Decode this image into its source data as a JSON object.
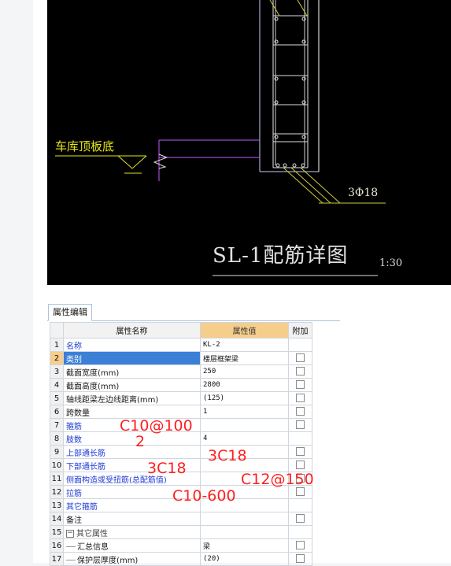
{
  "drawing": {
    "label_slab": "车库顶板底",
    "label_rebar": "3Φ18",
    "title": "SL-1配筋详图",
    "scale": "1:30"
  },
  "panel": {
    "tab_label": "属性编辑",
    "columns": {
      "name": "属性名称",
      "value": "属性值",
      "extra": "附加"
    },
    "rows": [
      {
        "num": "1",
        "name": "名称",
        "value": "KL-2",
        "color": "blue",
        "check": false
      },
      {
        "num": "2",
        "name": "类别",
        "value": "楼层框架梁",
        "color": "blue",
        "check": true
      },
      {
        "num": "3",
        "name": "截面宽度(mm)",
        "value": "250",
        "color": "black",
        "check": true
      },
      {
        "num": "4",
        "name": "截面高度(mm)",
        "value": "2800",
        "color": "black",
        "check": true
      },
      {
        "num": "5",
        "name": "轴线距梁左边线距离(mm)",
        "value": "(125)",
        "color": "black",
        "check": true
      },
      {
        "num": "6",
        "name": "跨数量",
        "value": "1",
        "color": "black",
        "check": true
      },
      {
        "num": "7",
        "name": "箍筋",
        "value": "",
        "color": "blue",
        "check": true
      },
      {
        "num": "8",
        "name": "肢数",
        "value": "4",
        "color": "blue",
        "check": false
      },
      {
        "num": "9",
        "name": "上部通长筋",
        "value": "",
        "color": "blue",
        "check": true
      },
      {
        "num": "10",
        "name": "下部通长筋",
        "value": "",
        "color": "blue",
        "check": true
      },
      {
        "num": "11",
        "name": "侧面构造或受扭筋(总配筋值)",
        "value": "",
        "color": "blue",
        "check": true
      },
      {
        "num": "12",
        "name": "拉筋",
        "value": "",
        "color": "blue",
        "check": true
      },
      {
        "num": "13",
        "name": "其它箍筋",
        "value": "",
        "color": "blue",
        "check": false
      },
      {
        "num": "14",
        "name": "备注",
        "value": "",
        "color": "black",
        "check": true
      },
      {
        "num": "15",
        "name": "其它属性",
        "value": "",
        "color": "gray",
        "check": false
      },
      {
        "num": "16",
        "name": "汇总信息",
        "value": "梁",
        "color": "black",
        "check": true
      },
      {
        "num": "17",
        "name": "保护层厚度(mm)",
        "value": "(20)",
        "color": "black",
        "check": true
      }
    ],
    "expander_symbol": "−"
  },
  "annotations": {
    "stirrup": "C10@100",
    "legs": "2",
    "top_bar": "3C18",
    "bottom_bar": "3C18",
    "side_bar": "C12@150",
    "tie_bar": "C10-600"
  },
  "colors": {
    "selected_row": "#3c7fd6",
    "header_accent": "#f6ce8c",
    "annotation_red": "#ff1f1f",
    "cad_yellow": "#e6e619"
  }
}
